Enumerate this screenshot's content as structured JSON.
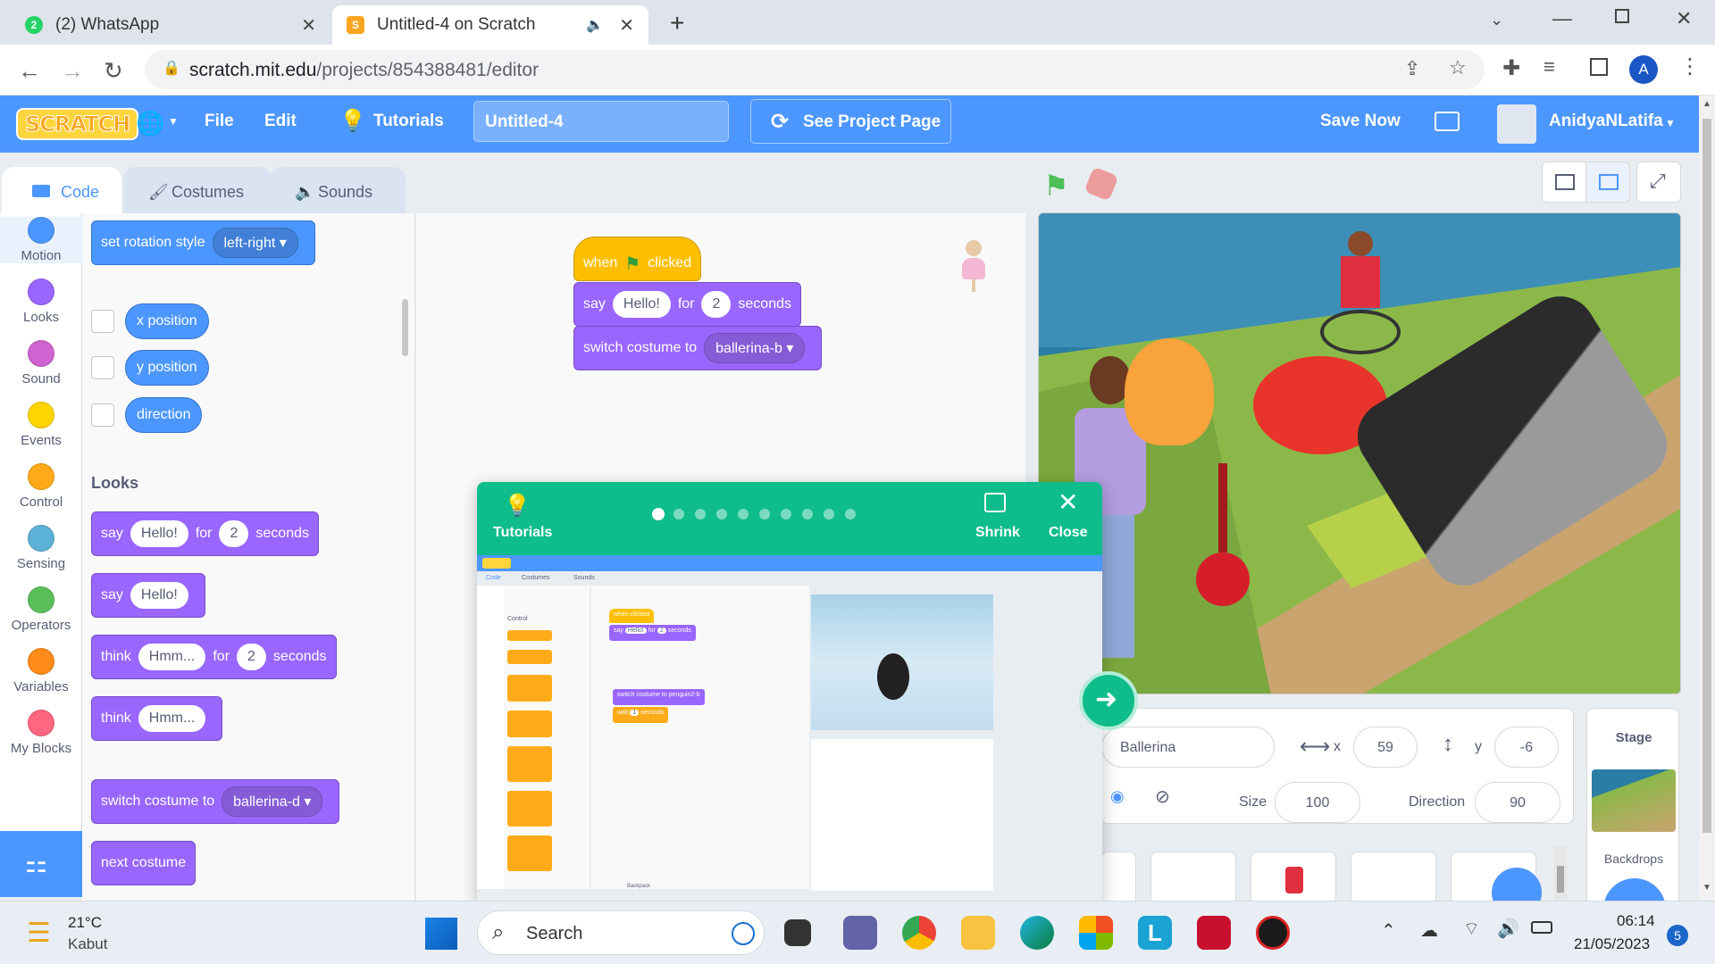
{
  "browser": {
    "tabs": [
      {
        "label": "(2) WhatsApp",
        "badge": "2"
      },
      {
        "label": "Untitled-4 on Scratch"
      }
    ],
    "url_domain": "scratch.mit.edu",
    "url_path": "/projects/854388481/editor",
    "profile_initial": "A"
  },
  "menubar": {
    "logo": "SCRATCH",
    "file": "File",
    "edit": "Edit",
    "tutorials": "Tutorials",
    "project_title": "Untitled-4",
    "see_project": "See Project Page",
    "save_now": "Save Now",
    "username": "AnidyaNLatifa"
  },
  "editor_tabs": {
    "code": "Code",
    "costumes": "Costumes",
    "sounds": "Sounds"
  },
  "categories": [
    {
      "label": "Motion",
      "color": "#4c97ff"
    },
    {
      "label": "Looks",
      "color": "#9966ff"
    },
    {
      "label": "Sound",
      "color": "#cf63cf"
    },
    {
      "label": "Events",
      "color": "#ffd500"
    },
    {
      "label": "Control",
      "color": "#ffab19"
    },
    {
      "label": "Sensing",
      "color": "#5cb1d6"
    },
    {
      "label": "Operators",
      "color": "#59c059"
    },
    {
      "label": "Variables",
      "color": "#ff8c1a"
    },
    {
      "label": "My Blocks",
      "color": "#ff6680"
    }
  ],
  "palette": {
    "rotation_style": "set rotation style",
    "rotation_value": "left-right",
    "x_position": "x position",
    "y_position": "y position",
    "direction": "direction",
    "looks_heading": "Looks",
    "say": "say",
    "hello": "Hello!",
    "for": "for",
    "two": "2",
    "seconds": "seconds",
    "think": "think",
    "hmm": "Hmm...",
    "switch_costume": "switch costume to",
    "costume_value": "ballerina-d",
    "next_costume": "next costume"
  },
  "script": {
    "when": "when",
    "clicked": "clicked",
    "say": "say",
    "hello": "Hello!",
    "for": "for",
    "two": "2",
    "seconds": "seconds",
    "switch_costume": "switch costume to",
    "costume_value": "ballerina-b"
  },
  "tutorial": {
    "label": "Tutorials",
    "shrink": "Shrink",
    "close": "Close",
    "dots": 10,
    "active_dot": 0,
    "mini": {
      "code": "Code",
      "costumes": "Costumes",
      "sounds": "Sounds",
      "control": "Control",
      "when_clicked": "when clicked",
      "say": "say",
      "hello": "Hello!",
      "for": "for",
      "two": "2",
      "seconds": "seconds",
      "switch_costume": "switch costume to",
      "costume_value": "penguin2-b",
      "wait": "wait",
      "wait_seconds": "seconds",
      "backpack": "Backpack"
    }
  },
  "sprite_info": {
    "sprite_name": "Ballerina",
    "x_label": "x",
    "x": "59",
    "y_label": "y",
    "y": "-6",
    "size_label": "Size",
    "size": "100",
    "direction_label": "Direction",
    "direction": "90"
  },
  "stage_panel": {
    "title": "Stage",
    "backdrops": "Backdrops"
  },
  "taskbar": {
    "temp": "21°C",
    "weather": "Kabut",
    "search": "Search",
    "time": "06:14",
    "date": "21/05/2023",
    "notif_count": "5"
  }
}
